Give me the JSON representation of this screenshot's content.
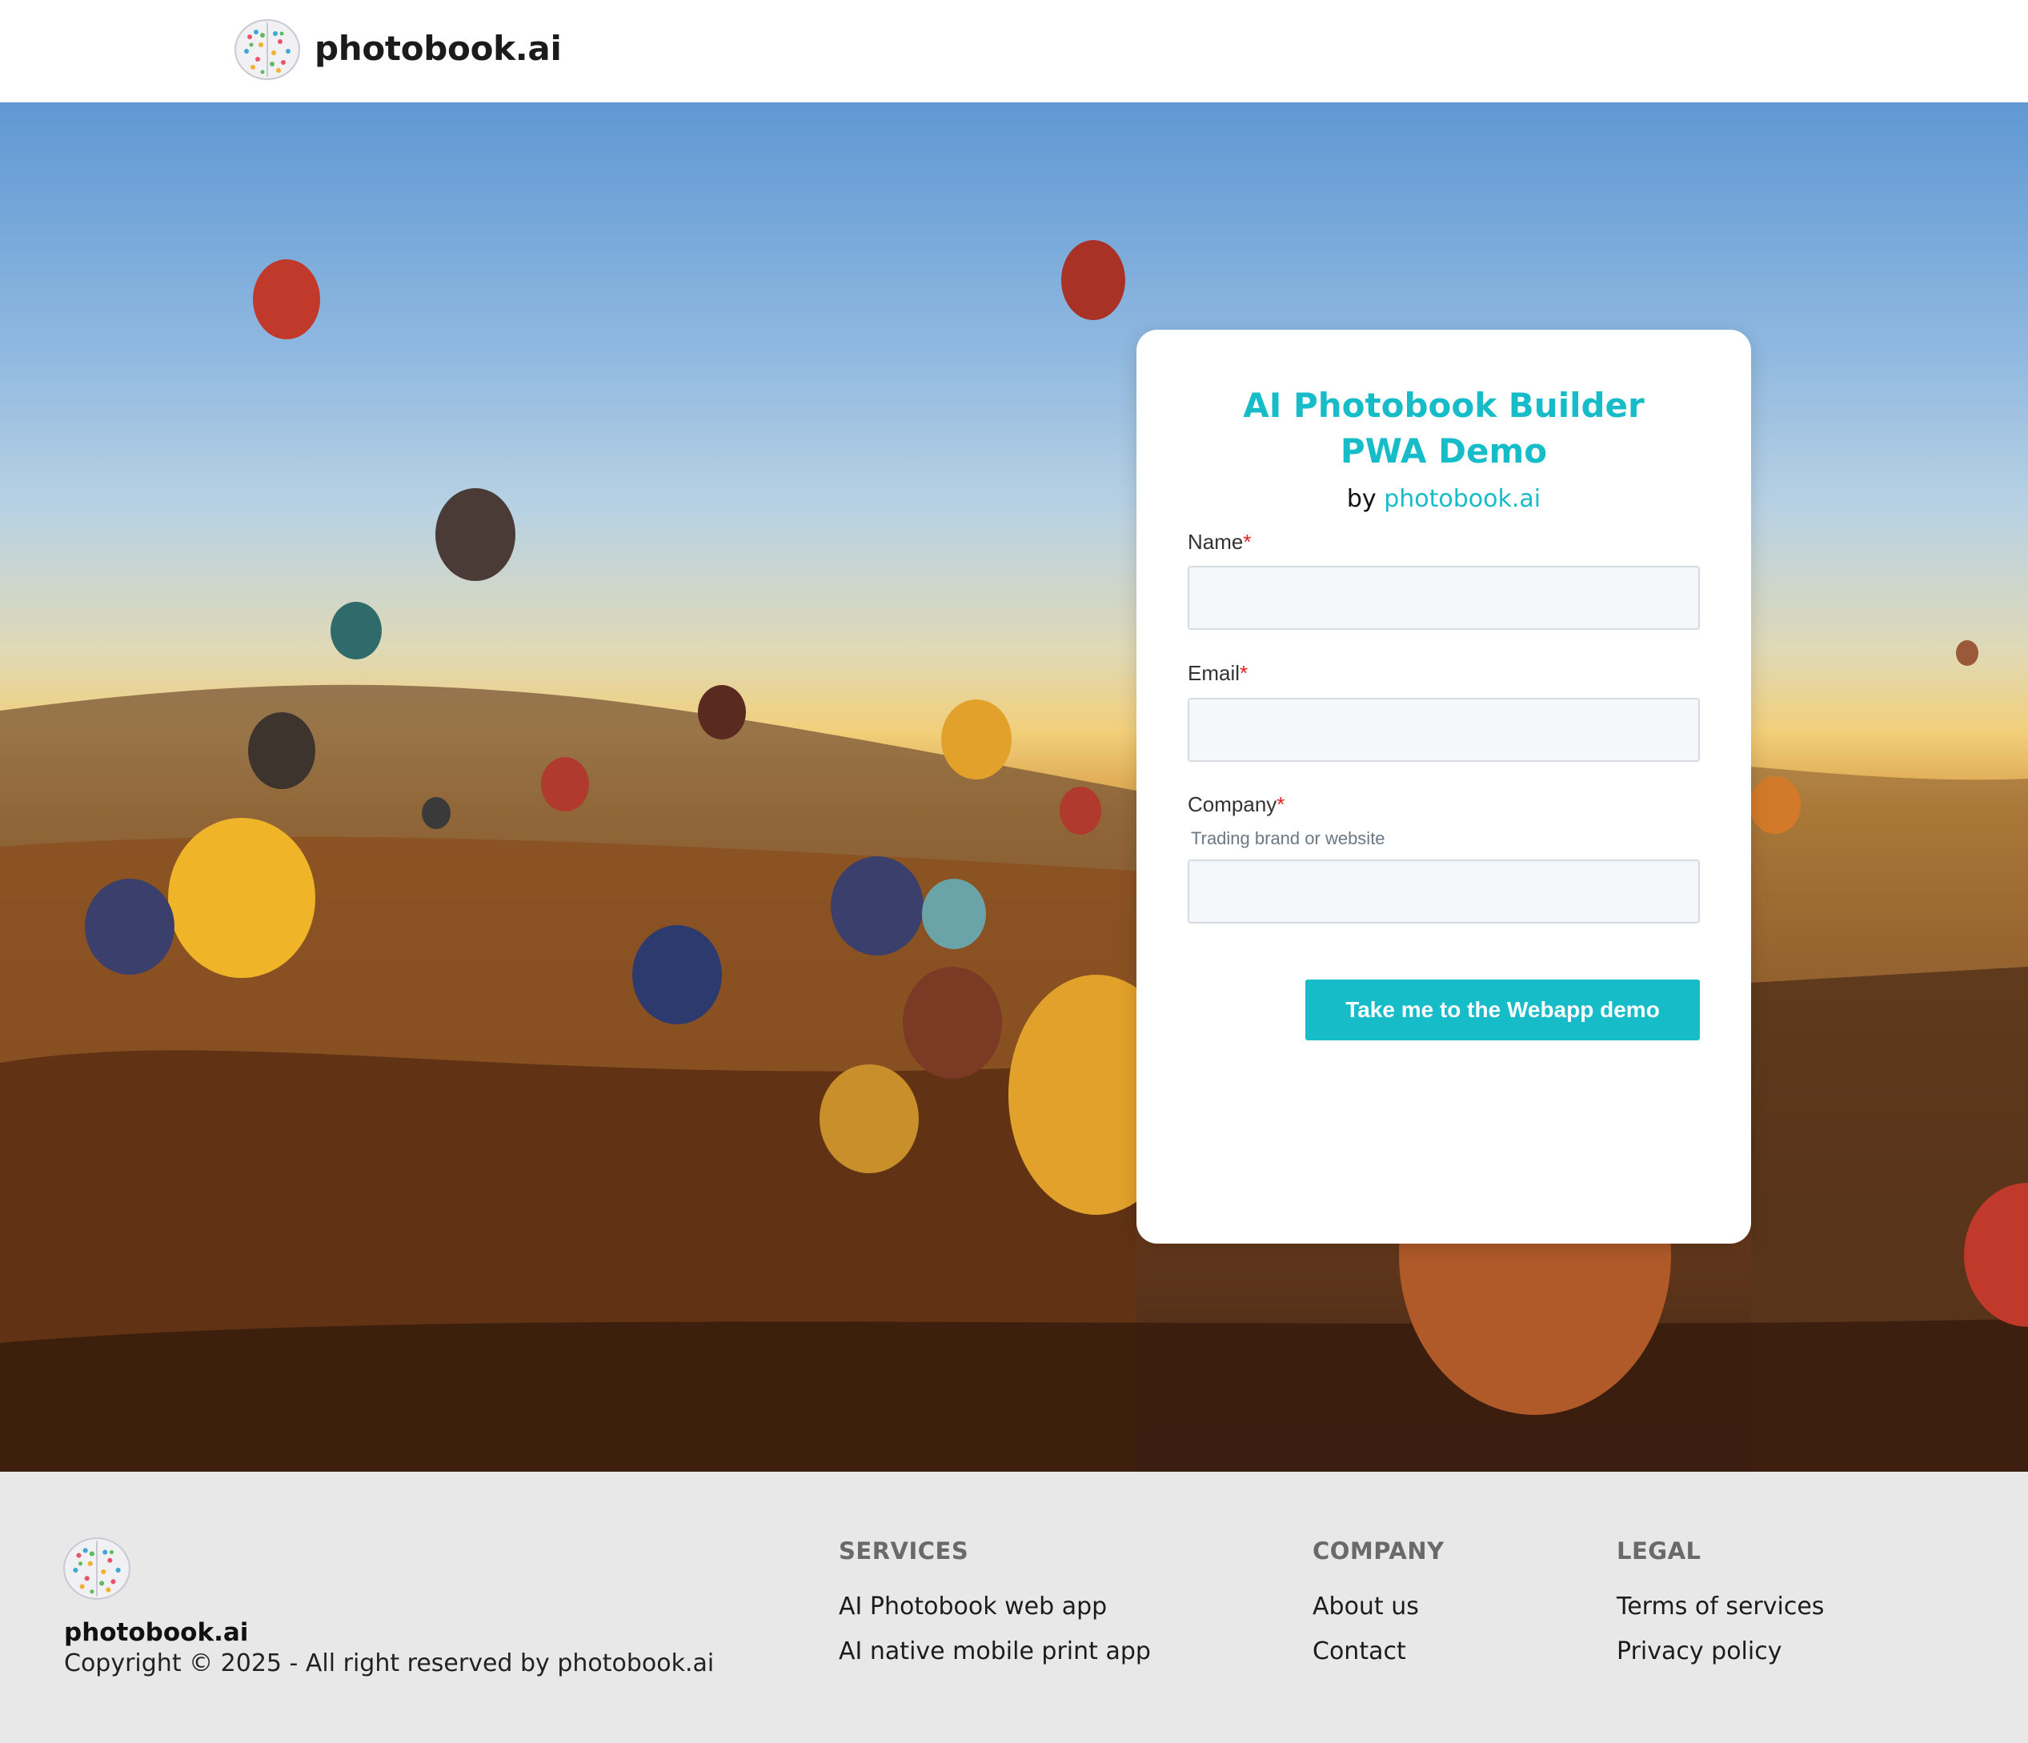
{
  "header": {
    "logo_icon": "brain-logo-icon",
    "brand": "photobook.ai"
  },
  "card": {
    "title_line1": "AI Photobook Builder",
    "title_line2": "PWA Demo",
    "by_prefix": "by",
    "by_link": "photobook.ai",
    "fields": [
      {
        "label": "Name",
        "required_mark": "*",
        "value": ""
      },
      {
        "label": "Email",
        "required_mark": "*",
        "value": ""
      },
      {
        "label": "Company",
        "required_mark": "*",
        "hint": "Trading brand or website",
        "value": ""
      }
    ],
    "submit_label": "Take me to the Webapp demo"
  },
  "footer": {
    "logo_icon": "brain-logo-icon",
    "brand": "photobook.ai",
    "copyright": "Copyright © 2025 - All right reserved by photobook.ai",
    "columns": [
      {
        "heading": "SERVICES",
        "links": [
          "AI Photobook web app",
          "AI native mobile print app"
        ]
      },
      {
        "heading": "COMPANY",
        "links": [
          "About us",
          "Contact"
        ]
      },
      {
        "heading": "LEGAL",
        "links": [
          "Terms of services",
          "Privacy policy"
        ]
      }
    ]
  },
  "colors": {
    "accent": "#17bcc9",
    "required": "#e0201b",
    "footer_bg": "#e8e8e8"
  }
}
